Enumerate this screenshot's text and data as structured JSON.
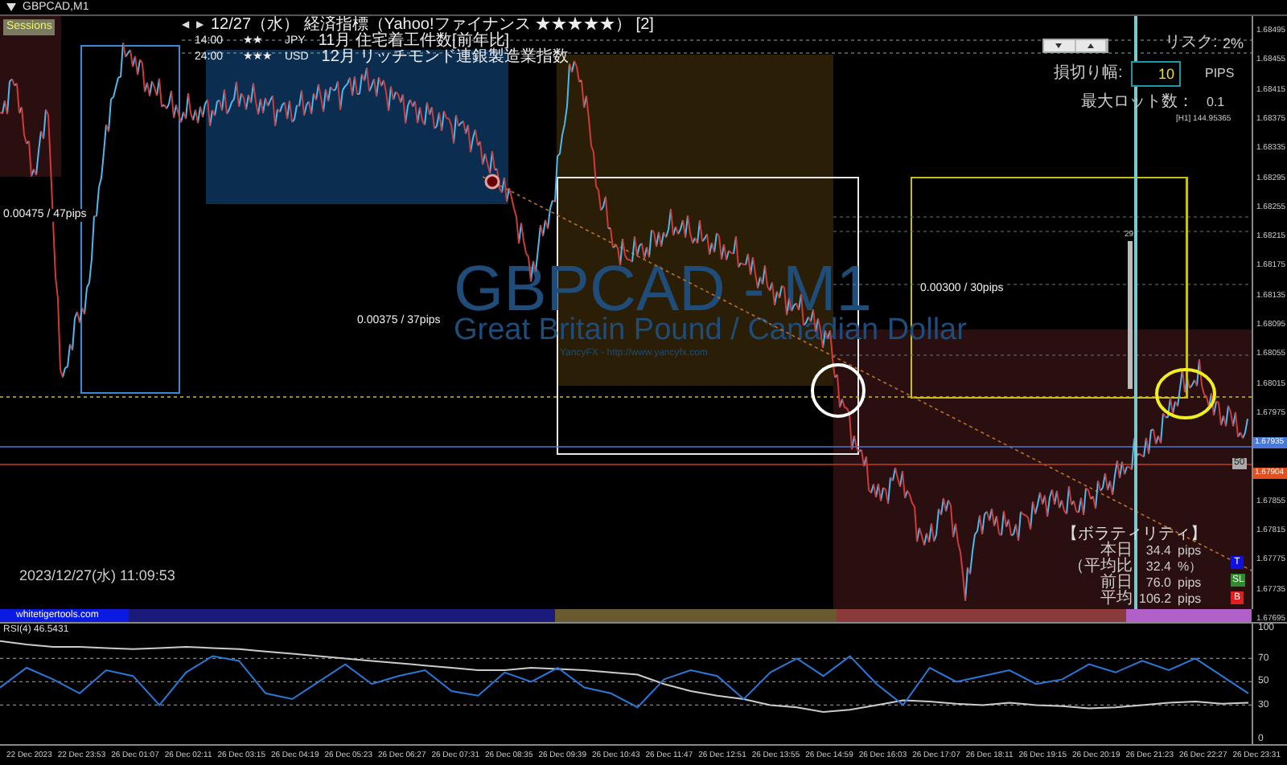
{
  "window": {
    "title": "GBPCAD,M1"
  },
  "sessions_button": {
    "label": "Sessions"
  },
  "news": {
    "prev": "◀",
    "next": "▶",
    "header": "12/27（水） 経済指標（Yahoo!ファイナンス ★★★★★） [2]",
    "events": [
      {
        "time": "14:00",
        "importance": "★★",
        "currency": "JPY",
        "title": "11月 住宅着工件数[前年比]"
      },
      {
        "time": "24:00",
        "importance": "★★★",
        "currency": "USD",
        "title": "12月 リッチモンド連銀製造業指数"
      }
    ]
  },
  "risk_panel": {
    "risk_label": "リスク:",
    "risk_value": "2%",
    "stop_label": "損切り幅:",
    "stop_value": "10",
    "stop_unit": "PIPS",
    "lot_label": "最大ロット数：",
    "lot_value": "0.1",
    "h1_reading": "[H1] 144.95365"
  },
  "watermark": {
    "symbol": "GBPCAD - M1",
    "name": "Great Britain Pound / Canadian Dollar",
    "credit": "YancyFX - http://www.yancyfx.com"
  },
  "range_labels": [
    "0.00475 / 47pips",
    "0.00375 / 37pips",
    "0.00300 / 30pips"
  ],
  "bar_count": "29",
  "line_tag": "50",
  "volatility": {
    "title": "【ボラティリティ】",
    "rows": [
      {
        "label": "本日",
        "value": "34.4",
        "unit": "pips"
      },
      {
        "label": "（平均比",
        "value": "32.4",
        "unit": "%）"
      },
      {
        "label": "前日",
        "value": "76.0",
        "unit": "pips"
      },
      {
        "label": "平均",
        "value": "106.2",
        "unit": "pips"
      }
    ]
  },
  "clock": "2023/12/27(水) 11:09:53",
  "trade_buttons": [
    {
      "label": "T",
      "color": "#1010e0"
    },
    {
      "label": "SL",
      "color": "#2e8b2e"
    },
    {
      "label": "B",
      "color": "#e02020"
    }
  ],
  "price_axis": {
    "labels": [
      {
        "kind": "tick",
        "text": "1.68495"
      },
      {
        "kind": "tick",
        "text": "1.68455"
      },
      {
        "kind": "tick",
        "text": "1.68415"
      },
      {
        "kind": "tick",
        "text": "1.68375"
      },
      {
        "kind": "tick",
        "text": "1.68335"
      },
      {
        "kind": "tick",
        "text": "1.68295"
      },
      {
        "kind": "tick",
        "text": "1.68255"
      },
      {
        "kind": "tick",
        "text": "1.68215"
      },
      {
        "kind": "tick",
        "text": "1.68175"
      },
      {
        "kind": "tick",
        "text": "1.68135"
      },
      {
        "kind": "tick",
        "text": "1.68095"
      },
      {
        "kind": "tick",
        "text": "1.68055"
      },
      {
        "kind": "tick",
        "text": "1.68015"
      },
      {
        "kind": "tick",
        "text": "1.67975"
      },
      {
        "kind": "tag",
        "text": "1.67935",
        "color": "#4a78d8"
      },
      {
        "kind": "tag",
        "text": "1.67904",
        "color": "#e05020"
      },
      {
        "kind": "tick",
        "text": "1.67855"
      },
      {
        "kind": "tick",
        "text": "1.67815"
      },
      {
        "kind": "tick",
        "text": "1.67775"
      },
      {
        "kind": "tick",
        "text": "1.67735"
      },
      {
        "kind": "tick",
        "text": "1.67695"
      }
    ]
  },
  "session_bar": {
    "site": "whitetigertools.com"
  },
  "rsi": {
    "label": "RSI(4) 46.5431",
    "chart_data": {
      "type": "line",
      "grid": true,
      "ylim": [
        -5,
        100
      ],
      "yticks": [
        {
          "value": 100,
          "label": "100"
        },
        {
          "value": 70,
          "label": "70"
        },
        {
          "value": 50,
          "label": "50"
        },
        {
          "value": 30,
          "label": "30"
        },
        {
          "value": 0,
          "label": "0"
        }
      ],
      "series": [
        {
          "color": "#2a78d8",
          "values": [
            45,
            62,
            52,
            40,
            60,
            55,
            30,
            58,
            72,
            68,
            40,
            35,
            50,
            65,
            48,
            55,
            60,
            42,
            38,
            58,
            50,
            62,
            45,
            40,
            28,
            52,
            60,
            55,
            35,
            58,
            70,
            55,
            72,
            48,
            30,
            62,
            50,
            55,
            60,
            48,
            52,
            65,
            58,
            68,
            60,
            70,
            55,
            40
          ]
        },
        {
          "color": "#cccccc",
          "values": [
            85,
            82,
            80,
            80,
            79,
            78,
            79,
            80,
            79,
            78,
            76,
            74,
            72,
            70,
            68,
            66,
            64,
            62,
            60,
            60,
            62,
            61,
            60,
            58,
            56,
            48,
            42,
            38,
            35,
            30,
            28,
            24,
            26,
            30,
            34,
            33,
            31,
            30,
            32,
            30,
            29,
            27,
            28,
            30,
            32,
            33,
            31,
            32
          ]
        }
      ]
    }
  },
  "time_axis": {
    "labels": [
      "22 Dec 2023",
      "22 Dec 23:53",
      "26 Dec 01:07",
      "26 Dec 02:11",
      "26 Dec 03:15",
      "26 Dec 04:19",
      "26 Dec 05:23",
      "26 Dec 06:27",
      "26 Dec 07:31",
      "26 Dec 08:35",
      "26 Dec 09:39",
      "26 Dec 10:43",
      "26 Dec 11:47",
      "26 Dec 12:51",
      "26 Dec 13:55",
      "26 Dec 14:59",
      "26 Dec 16:03",
      "26 Dec 17:07",
      "26 Dec 18:11",
      "26 Dec 19:15",
      "26 Dec 20:19",
      "26 Dec 21:23",
      "26 Dec 22:27",
      "26 Dec 23:31"
    ]
  }
}
